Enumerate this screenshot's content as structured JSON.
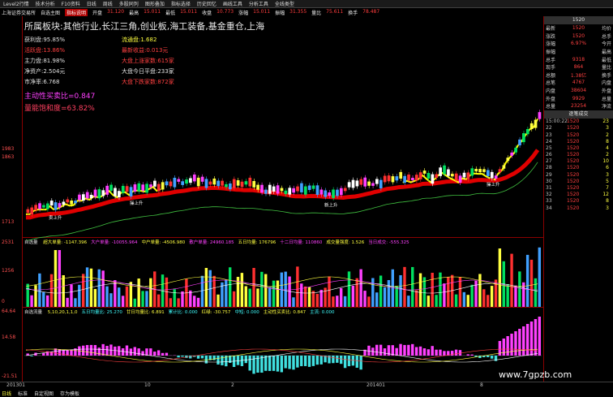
{
  "toolbar": {
    "items": [
      "Level2行情",
      "技术分析",
      "F10资料",
      "日线",
      "周线",
      "多股同列",
      "图形叠加",
      "指标选择",
      "历史回忆",
      "画线工具",
      "分析工具",
      "全线类型"
    ]
  },
  "infobar": {
    "title": "上海证券交易所",
    "chart_name": "自选主图",
    "tag": "指标说明",
    "values": [
      {
        "k": "开盘",
        "v": "31.120"
      },
      {
        "k": "最高",
        "v": "15.011"
      },
      {
        "k": "最低",
        "v": "15.011"
      },
      {
        "k": "收盘",
        "v": "10.773"
      },
      {
        "k": "涨幅",
        "v": "15.011"
      },
      {
        "k": "振幅",
        "v": "31.355"
      },
      {
        "k": "量比",
        "v": "75.611"
      },
      {
        "k": "换手",
        "v": "78.487"
      }
    ]
  },
  "info_box": {
    "board": "所属板块:其他行业,长江三角,创业板,海工装备,基金重仓,上海",
    "rows": [
      {
        "lab": "获利盘:95.85%",
        "lab_cls": "lab",
        "val": "流通盘:1.682",
        "val_cls": "val-y"
      },
      {
        "lab": "活跃盘:13.86%",
        "lab_cls": "val-r",
        "val": "最新收益:0.013元",
        "val_cls": "val-r"
      },
      {
        "lab": "主力盘:81.98%",
        "lab_cls": "lab",
        "val": "大盘上涨家数:615家",
        "val_cls": "val-r"
      },
      {
        "lab": "净资产:2.504元",
        "lab_cls": "lab",
        "val": "大盘今日平盘:233家",
        "val_cls": "lab"
      },
      {
        "lab": "市净率:6.768",
        "lab_cls": "lab",
        "val": "大盘下跌家数:872家",
        "val_cls": "val-r"
      }
    ]
  },
  "ratio": {
    "line1": "主动性买卖比=0.847",
    "line2": "量能饱和度=63.82%"
  },
  "panel2": {
    "title": "自选量",
    "items": [
      "超大单量: -1147.396",
      "大户单量: -10055.964",
      "中户单量: -4506.980",
      "散户单量: 24960.185",
      "五日均量: 176796",
      "十二日均量: 110860",
      "成交量强度: 1.526",
      "当日成交: -555.325"
    ]
  },
  "panel3": {
    "title": "自选流量",
    "items": [
      "5,10,20,1,1,0",
      "五日均量比: 25.270",
      "廿日均量比: 6.891",
      "累计比: 0.000",
      "红绿: -30.757",
      "中短: 0.000",
      "主动性买卖比: 0.847",
      "主流: 0.000"
    ]
  },
  "left_axis": [
    "1983",
    "1863",
    "1713",
    "2531",
    "1256",
    "0",
    "64.64",
    "14.58",
    "-21.51"
  ],
  "right_panel": {
    "stock_name": "1520",
    "rows": [
      {
        "a": "最新",
        "b": "1520",
        "c": "均价"
      },
      {
        "a": "涨跌",
        "b": "1520",
        "c": "总手"
      },
      {
        "a": "涨幅",
        "b": "6.97%",
        "c": "今开"
      },
      {
        "a": "振幅",
        "b": "",
        "c": "最高"
      },
      {
        "a": "总手",
        "b": "9318",
        "c": "最低"
      },
      {
        "a": "现手",
        "b": "864",
        "c": "量比"
      },
      {
        "a": "总额",
        "b": "1.38亿",
        "c": "换手"
      },
      {
        "a": "总笔",
        "b": "4767",
        "c": "内盘"
      },
      {
        "a": "内盘",
        "b": "38604",
        "c": "外盘"
      },
      {
        "a": "外盘",
        "b": "9929",
        "c": "总量"
      },
      {
        "a": "总量",
        "b": "23254",
        "c": "净流"
      }
    ],
    "tick_header": "逐笔成交",
    "ticks": [
      {
        "t": "15:00:22",
        "p": "1520",
        "v": "23"
      },
      {
        "t": "22",
        "p": "1520",
        "v": "3"
      },
      {
        "t": "23",
        "p": "1520",
        "v": "2"
      },
      {
        "t": "24",
        "p": "1520",
        "v": "8"
      },
      {
        "t": "25",
        "p": "1520",
        "v": "4"
      },
      {
        "t": "26",
        "p": "1520",
        "v": "2"
      },
      {
        "t": "27",
        "p": "1520",
        "v": "10"
      },
      {
        "t": "28",
        "p": "1520",
        "v": "6"
      },
      {
        "t": "29",
        "p": "1520",
        "v": "3"
      },
      {
        "t": "30",
        "p": "1520",
        "v": "5"
      },
      {
        "t": "31",
        "p": "1520",
        "v": "7"
      },
      {
        "t": "32",
        "p": "1520",
        "v": "12"
      },
      {
        "t": "33",
        "p": "1520",
        "v": "8"
      },
      {
        "t": "34",
        "p": "1520",
        "v": "3"
      }
    ]
  },
  "status": {
    "dates": [
      "201301",
      "10",
      "2",
      "201401",
      "8"
    ],
    "tabs": [
      "日线",
      "标准",
      "自定视图",
      "存为模板"
    ]
  },
  "watermark": "www.7gpzb.com",
  "annotations": [
    "卖上升",
    "操上升",
    "新上升",
    "操上升"
  ],
  "chart_data": [
    {
      "type": "candlestick",
      "title": "",
      "ylim": [
        1713,
        1983
      ],
      "yticks": [
        "1983",
        "1863",
        "1713"
      ],
      "colors": {
        "up": "#ff3030",
        "down": "#00c0ff",
        "ma_red": "#e00000",
        "ma_yellow": "#ffff00",
        "ma_green": "#40c040"
      }
    },
    {
      "type": "bar",
      "title": "自选量",
      "ylim": [
        0,
        2531
      ],
      "yticks": [
        "2531",
        "1256",
        "0"
      ]
    },
    {
      "type": "bar",
      "title": "自选流量",
      "ylim": [
        -21.51,
        64.64
      ],
      "yticks": [
        "64.64",
        "14.58",
        "-21.51"
      ]
    }
  ]
}
